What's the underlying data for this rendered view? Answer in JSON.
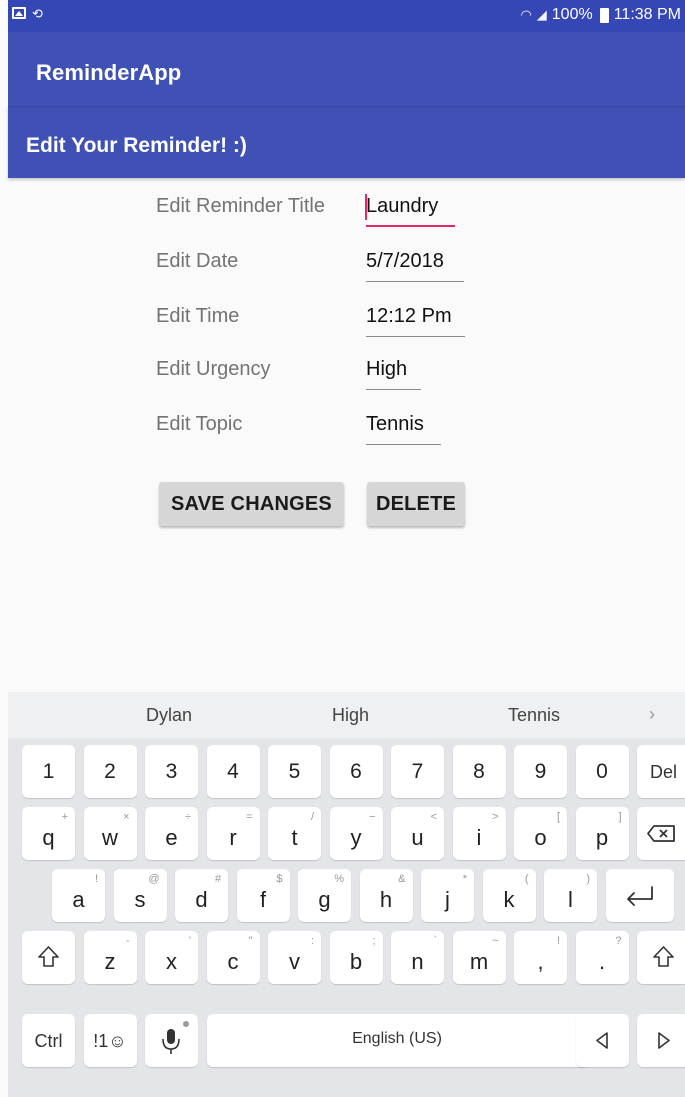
{
  "status_bar": {
    "icons_left": [
      "gallery-icon",
      "sync-icon"
    ],
    "battery": "100%",
    "time": "11:38 PM"
  },
  "app": {
    "title": "ReminderApp"
  },
  "screen": {
    "heading": "Edit Your Reminder! :)"
  },
  "form": {
    "rows": [
      {
        "label": "Edit Reminder Title",
        "value": "Laundry"
      },
      {
        "label": "Edit Date",
        "value": "5/7/2018"
      },
      {
        "label": "Edit Time",
        "value": "12:12 Pm"
      },
      {
        "label": "Edit Urgency",
        "value": "High"
      },
      {
        "label": "Edit Topic",
        "value": "Tennis"
      }
    ],
    "save_label": "SAVE CHANGES",
    "delete_label": "DELETE"
  },
  "keyboard": {
    "suggestions": [
      "Dylan",
      "High",
      "Tennis"
    ],
    "suggest_arrow": "›",
    "number_row": [
      "1",
      "2",
      "3",
      "4",
      "5",
      "6",
      "7",
      "8",
      "9",
      "0"
    ],
    "del_label": "Del",
    "row1": [
      {
        "k": "q",
        "h": "+"
      },
      {
        "k": "w",
        "h": "×"
      },
      {
        "k": "e",
        "h": "÷"
      },
      {
        "k": "r",
        "h": "="
      },
      {
        "k": "t",
        "h": "/"
      },
      {
        "k": "y",
        "h": "−"
      },
      {
        "k": "u",
        "h": "<"
      },
      {
        "k": "i",
        "h": ">"
      },
      {
        "k": "o",
        "h": "["
      },
      {
        "k": "p",
        "h": "]"
      }
    ],
    "row2": [
      {
        "k": "a",
        "h": "!"
      },
      {
        "k": "s",
        "h": "@"
      },
      {
        "k": "d",
        "h": "#"
      },
      {
        "k": "f",
        "h": "$"
      },
      {
        "k": "g",
        "h": "%"
      },
      {
        "k": "h",
        "h": "&"
      },
      {
        "k": "j",
        "h": "*"
      },
      {
        "k": "k",
        "h": "("
      },
      {
        "k": "l",
        "h": ")"
      }
    ],
    "row3": [
      {
        "k": "z",
        "h": "-"
      },
      {
        "k": "x",
        "h": "'"
      },
      {
        "k": "c",
        "h": "\""
      },
      {
        "k": "v",
        "h": ":"
      },
      {
        "k": "b",
        "h": ";"
      },
      {
        "k": "n",
        "h": "`"
      },
      {
        "k": "m",
        "h": "~"
      },
      {
        "k": ",",
        "h": "!"
      },
      {
        "k": ".",
        "h": "?"
      }
    ],
    "ctrl_label": "Ctrl",
    "symbols_label": "!1☺",
    "space_label": "English (US)"
  },
  "colors": {
    "primary": "#3f51b5",
    "status_bar": "#3546b5",
    "accent": "#e2266a",
    "button": "#d6d6d6",
    "keyboard_bg": "#e3e5e8"
  }
}
